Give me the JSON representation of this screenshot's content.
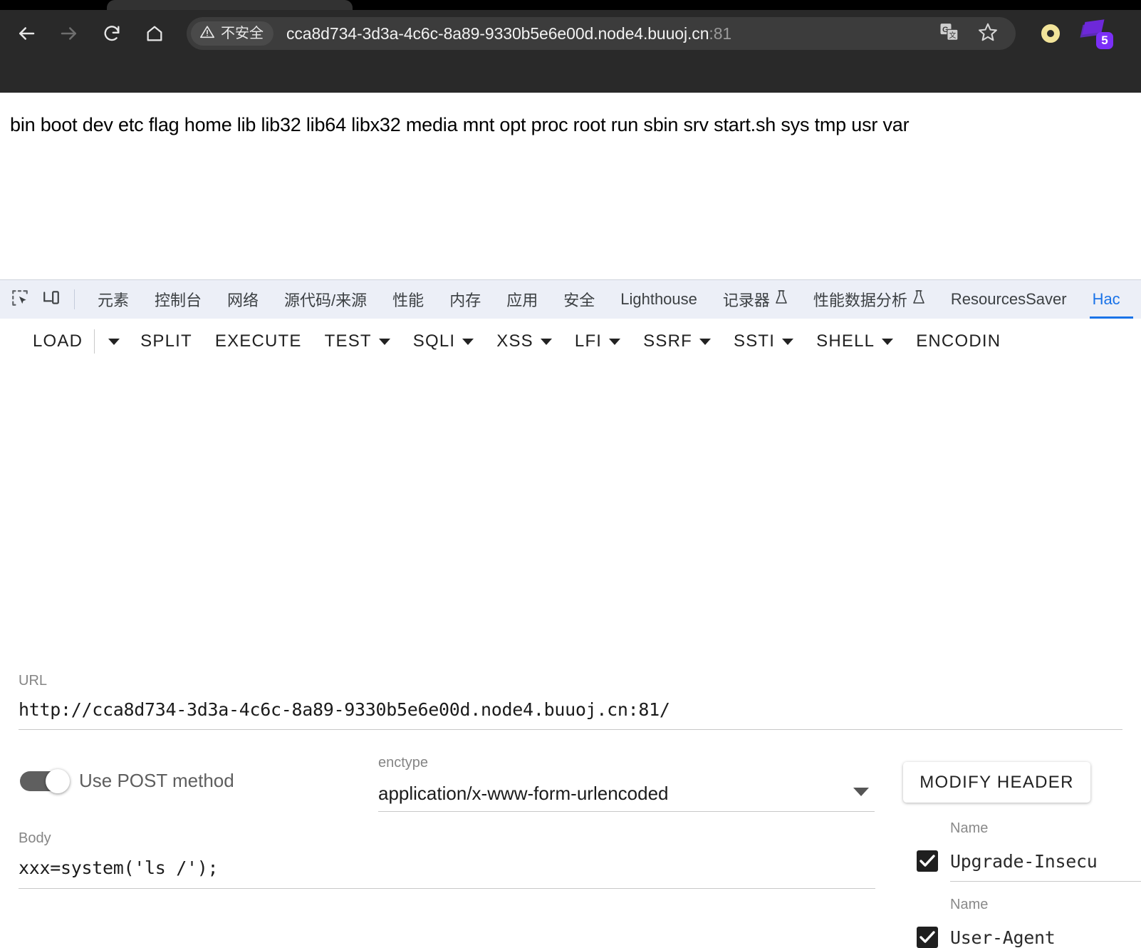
{
  "browser": {
    "nav": {
      "back_icon": "arrow-left-icon",
      "forward_icon": "arrow-right-icon",
      "reload_icon": "reload-icon",
      "home_icon": "home-icon"
    },
    "omnibox": {
      "security_label": "不安全",
      "security_icon": "warning-triangle-icon",
      "url_host": "cca8d734-3d3a-4c6c-8a89-9330b5e6e00d.node4.buuoj.cn",
      "url_port": ":81",
      "translate_icon": "translate-icon",
      "bookmark_icon": "star-icon"
    },
    "extensions": [
      {
        "name": "ring-extension-icon",
        "color": "#f2e49a",
        "badge": ""
      },
      {
        "name": "purple-extension-icon",
        "color": "#6d28d9",
        "badge": "5"
      }
    ]
  },
  "page": {
    "body_text": "bin boot dev etc flag home lib lib32 lib64 libx32 media mnt opt proc root run sbin srv start.sh sys tmp usr var"
  },
  "devtools": {
    "inspect_icon": "inspect-element-icon",
    "device_icon": "device-toolbar-icon",
    "tabs": [
      {
        "label": "元素",
        "active": false,
        "icon": ""
      },
      {
        "label": "控制台",
        "active": false,
        "icon": ""
      },
      {
        "label": "网络",
        "active": false,
        "icon": ""
      },
      {
        "label": "源代码/来源",
        "active": false,
        "icon": ""
      },
      {
        "label": "性能",
        "active": false,
        "icon": ""
      },
      {
        "label": "内存",
        "active": false,
        "icon": ""
      },
      {
        "label": "应用",
        "active": false,
        "icon": ""
      },
      {
        "label": "安全",
        "active": false,
        "icon": ""
      },
      {
        "label": "Lighthouse",
        "active": false,
        "icon": ""
      },
      {
        "label": "记录器",
        "active": false,
        "icon": "flask-icon"
      },
      {
        "label": "性能数据分析",
        "active": false,
        "icon": "flask-icon"
      },
      {
        "label": "ResourcesSaver",
        "active": false,
        "icon": ""
      },
      {
        "label": "Hac",
        "active": true,
        "icon": ""
      }
    ],
    "accent_color": "#1a73e8"
  },
  "hackbar": {
    "toolbar": [
      {
        "label": "LOAD",
        "has_caret": false,
        "split_caret": true
      },
      {
        "label": "SPLIT",
        "has_caret": false
      },
      {
        "label": "EXECUTE",
        "has_caret": false
      },
      {
        "label": "TEST",
        "has_caret": true
      },
      {
        "label": "SQLI",
        "has_caret": true
      },
      {
        "label": "XSS",
        "has_caret": true
      },
      {
        "label": "LFI",
        "has_caret": true
      },
      {
        "label": "SSRF",
        "has_caret": true
      },
      {
        "label": "SSTI",
        "has_caret": true
      },
      {
        "label": "SHELL",
        "has_caret": true
      },
      {
        "label": "ENCODIN",
        "has_caret": false
      }
    ],
    "url_field": {
      "label": "URL",
      "value": "http://cca8d734-3d3a-4c6c-8a89-9330b5e6e00d.node4.buuoj.cn:81/"
    },
    "post_toggle": {
      "label": "Use POST method",
      "enabled": true
    },
    "enctype_field": {
      "label": "enctype",
      "value": "application/x-www-form-urlencoded"
    },
    "body_field": {
      "label": "Body",
      "value": "xxx=system('ls /');"
    },
    "header_panel": {
      "modify_button": "MODIFY HEADER",
      "rows": [
        {
          "label": "Name",
          "value": "Upgrade-Insecu",
          "checked": true
        },
        {
          "label": "Name",
          "value": "User-Agent",
          "checked": true
        }
      ]
    }
  }
}
